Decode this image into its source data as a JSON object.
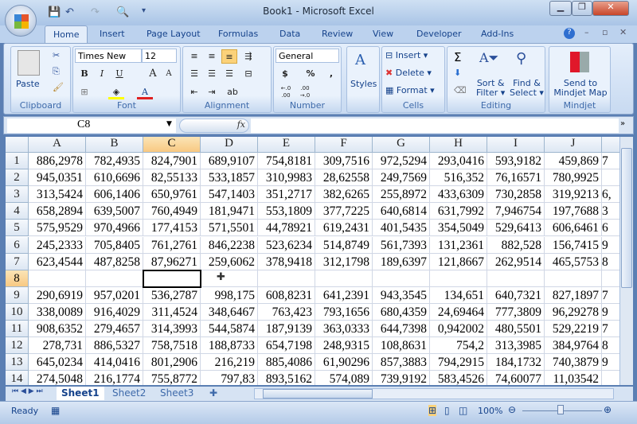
{
  "window": {
    "title": "Book1 - Microsoft Excel",
    "minimize": "▁",
    "restore": "❐",
    "close": "✕"
  },
  "qat": {
    "save": "save-icon",
    "undo": "↶",
    "redo": "↷",
    "preview": "print-preview-icon",
    "customize": "▾"
  },
  "tabs": [
    "Home",
    "Insert",
    "Page Layout",
    "Formulas",
    "Data",
    "Review",
    "View",
    "Developer",
    "Add-Ins"
  ],
  "ribbon": {
    "clipboard": {
      "label": "Clipboard",
      "paste": "Paste"
    },
    "font": {
      "label": "Font",
      "name": "Times New Rc",
      "size": "12",
      "bold": "B",
      "italic": "I",
      "underline": "U",
      "grow": "A",
      "shrink": "A",
      "color_font": "#e02020",
      "color_fill": "#ffff00"
    },
    "alignment": {
      "label": "Alignment"
    },
    "number": {
      "label": "Number",
      "format": "General",
      "currency": "$",
      "percent": "%",
      "comma": ",",
      "inc": "←.0 .00",
      "dec": ".00 →.0"
    },
    "styles": {
      "label": "Styles"
    },
    "cells": {
      "label": "Cells",
      "insert": "Insert",
      "delete": "Delete",
      "format": "Format"
    },
    "editing": {
      "label": "Editing",
      "sum": "Σ",
      "sort": "Sort &",
      "sort2": "Filter",
      "find": "Find &",
      "find2": "Select"
    },
    "mindjet": {
      "label": "Mindjet",
      "send": "Send to",
      "send2": "Mindjet Map"
    }
  },
  "formula_bar": {
    "name_box": "C8",
    "fx": "fx",
    "value": ""
  },
  "sheet": {
    "columns": [
      "A",
      "B",
      "C",
      "D",
      "E",
      "F",
      "G",
      "H",
      "I",
      "J",
      "K"
    ],
    "selected_col": "C",
    "selected_row": 8,
    "rows": [
      {
        "n": 1,
        "cells": [
          "886,2978",
          "782,4935",
          "824,7901",
          "689,9107",
          "754,8181",
          "309,7516",
          "972,5294",
          "293,0416",
          "593,9182",
          "459,869",
          "7"
        ]
      },
      {
        "n": 2,
        "cells": [
          "945,0351",
          "610,6696",
          "82,55133",
          "533,1857",
          "310,9983",
          "28,62558",
          "249,7569",
          "516,352",
          "76,16571",
          "780,9925",
          ""
        ]
      },
      {
        "n": 3,
        "cells": [
          "313,5424",
          "606,1406",
          "650,9761",
          "547,1403",
          "351,2717",
          "382,6265",
          "255,8972",
          "433,6309",
          "730,2858",
          "319,9213",
          "6,"
        ]
      },
      {
        "n": 4,
        "cells": [
          "658,2894",
          "639,5007",
          "760,4949",
          "181,9471",
          "553,1809",
          "377,7225",
          "640,6814",
          "631,7992",
          "7,946754",
          "197,7688",
          "3"
        ]
      },
      {
        "n": 5,
        "cells": [
          "575,9529",
          "970,4966",
          "177,4153",
          "571,5501",
          "44,78921",
          "619,2431",
          "401,5435",
          "354,5049",
          "529,6413",
          "606,6461",
          "6"
        ]
      },
      {
        "n": 6,
        "cells": [
          "245,2333",
          "705,8405",
          "761,2761",
          "846,2238",
          "523,6234",
          "514,8749",
          "561,7393",
          "131,2361",
          "882,528",
          "156,7415",
          "9"
        ]
      },
      {
        "n": 7,
        "cells": [
          "623,4544",
          "487,8258",
          "87,96271",
          "259,6062",
          "378,9418",
          "312,1798",
          "189,6397",
          "121,8667",
          "262,9514",
          "465,5753",
          "8"
        ]
      },
      {
        "n": 8,
        "cells": [
          "",
          "",
          "",
          "",
          "",
          "",
          "",
          "",
          "",
          "",
          ""
        ]
      },
      {
        "n": 9,
        "cells": [
          "290,6919",
          "957,0201",
          "536,2787",
          "998,175",
          "608,8231",
          "641,2391",
          "943,3545",
          "134,651",
          "640,7321",
          "827,1897",
          "7"
        ]
      },
      {
        "n": 10,
        "cells": [
          "338,0089",
          "916,4029",
          "311,4524",
          "348,6467",
          "763,423",
          "793,1656",
          "680,4359",
          "24,69464",
          "777,3809",
          "96,29278",
          "9"
        ]
      },
      {
        "n": 11,
        "cells": [
          "908,6352",
          "279,4657",
          "314,3993",
          "544,5874",
          "187,9139",
          "363,0333",
          "644,7398",
          "0,942002",
          "480,5501",
          "529,2219",
          "7"
        ]
      },
      {
        "n": 12,
        "cells": [
          "278,731",
          "886,5327",
          "758,7518",
          "188,8733",
          "654,7198",
          "248,9315",
          "108,8631",
          "754,2",
          "313,3985",
          "384,9764",
          "8"
        ]
      },
      {
        "n": 13,
        "cells": [
          "645,0234",
          "414,0416",
          "801,2906",
          "216,219",
          "885,4086",
          "61,90296",
          "857,3883",
          "794,2915",
          "184,1732",
          "740,3879",
          "9"
        ]
      },
      {
        "n": 14,
        "cells": [
          "274,5048",
          "216,1774",
          "755,8772",
          "797,83",
          "893,5162",
          "574,089",
          "739,9192",
          "583,4526",
          "74,60077",
          "11,03542",
          ""
        ]
      }
    ]
  },
  "sheet_tabs": [
    "Sheet1",
    "Sheet2",
    "Sheet3"
  ],
  "active_sheet": "Sheet1",
  "status": {
    "text": "Ready",
    "zoom": "100%",
    "zoom_level": 100
  }
}
